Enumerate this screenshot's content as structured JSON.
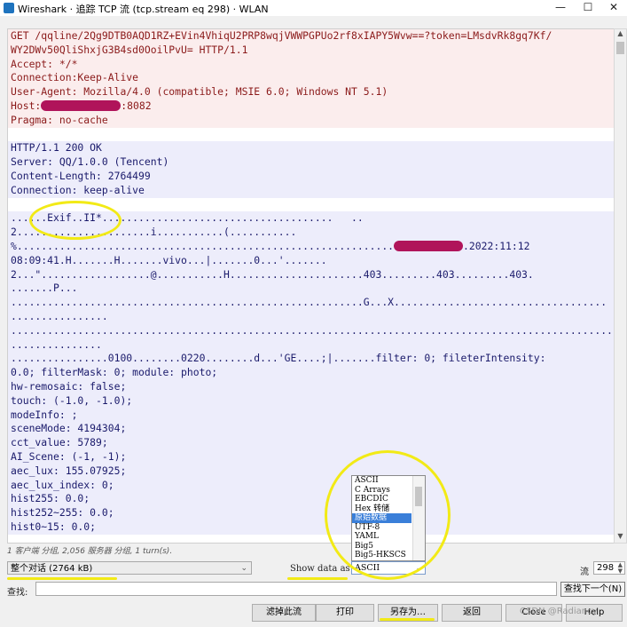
{
  "window": {
    "title": "Wireshark · 追踪 TCP 流 (tcp.stream eq 298) · WLAN",
    "minimize": "—",
    "maximize": "☐",
    "close": "✕"
  },
  "request_lines": [
    "GET /qqline/2Qg9DTB0AQD1RZ+EVin4VhiqU2PRP8wqjVWWPGPUo2rf8xIAPY5Wvw==?token=LMsdvRk8gq7Kf/",
    "WY2DWv50QliShxjG3B4sd0OoilPvU= HTTP/1.1",
    "Accept: */*",
    "Connection:Keep-Alive",
    "User-Agent: Mozilla/4.0 (compatible; MSIE 6.0; Windows NT 5.1)"
  ],
  "host_label": "Host:",
  "host_port": ":8082",
  "pragma_line": "Pragma: no-cache",
  "response_headers": [
    "HTTP/1.1 200 OK",
    "Server: QQ/1.0.0 (Tencent)",
    "Content-Length: 2764499",
    "Connection: keep-alive"
  ],
  "body_line_1": "......Exif..II*......................................   ..",
  "body_line_2": "2......................i...........(...........",
  "body_line_3_prefix": "%..............................................................",
  "body_line_3_suffix": ".2022:11:12",
  "body_lines_after": [
    "08:09:41.H.......H.......vivo...|.......0...'.......",
    "2...\"..................@...........H......................403.........403.........403.",
    ".......P...",
    "..........................................................G...X...................................",
    "................",
    "......................................................................................................",
    "...............",
    "................0100........0220........d...'GE....;|.......filter: 0; fileterIntensity:",
    "0.0; filterMask: 0; module: photo;",
    "hw-remosaic: false;",
    "touch: (-1.0, -1.0);",
    "modeInfo: ;",
    "sceneMode: 4194304;",
    "cct_value: 5789;",
    "AI_Scene: (-1, -1);",
    "aec_lux: 155.07925;",
    "aec_lux_index: 0;",
    "hist255: 0.0;",
    "hist252~255: 0.0;",
    "hist0~15: 0.0;"
  ],
  "stats_text": "1 客户端 分组, 2,056 服务器 分组, 1 turn(s).",
  "conversation_select": "整个对话 (2764 kB)",
  "show_data_as_label": "Show data as",
  "format_select": "ASCII",
  "format_options": [
    "ASCII",
    "C Arrays",
    "EBCDIC",
    "Hex 转储",
    "原始数据",
    "UTF-8",
    "YAML",
    "Big5",
    "Big5-HKSCS"
  ],
  "format_selected_option": "原始数据",
  "stream_label": "流",
  "stream_value": "298",
  "find_label": "查找:",
  "find_value": "",
  "find_next_button": "查找下一个(N)",
  "buttons": {
    "filter_out": "滤掉此流",
    "print": "打印",
    "save_as": "另存为…",
    "back": "返回",
    "close": "Close",
    "help": "Help"
  },
  "watermark": "CSDN @Radiancy",
  "colors": {
    "client_text": "#8b1a1a",
    "client_bg": "#fbeded",
    "server_text": "#1a1a6b",
    "server_bg": "#ededfb",
    "highlight": "#f2ea16",
    "redaction": "#b0145a",
    "selected_option": "#3a7fd9"
  }
}
